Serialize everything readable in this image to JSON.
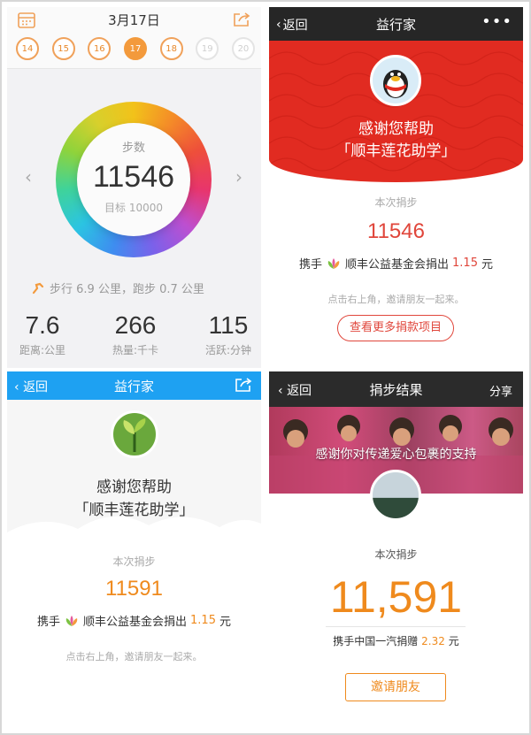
{
  "step_app": {
    "date": "3月17日",
    "days": [
      {
        "label": "14",
        "state": "normal"
      },
      {
        "label": "15",
        "state": "normal"
      },
      {
        "label": "16",
        "state": "normal"
      },
      {
        "label": "17",
        "state": "selected"
      },
      {
        "label": "18",
        "state": "normal"
      },
      {
        "label": "19",
        "state": "dim"
      },
      {
        "label": "20",
        "state": "dim"
      }
    ],
    "ring_label": "步数",
    "steps": "11546",
    "target": "目标 10000",
    "walk_summary": "步行 6.9 公里，跑步 0.7 公里",
    "stats": [
      {
        "value": "7.6",
        "label": "距离:公里"
      },
      {
        "value": "266",
        "label": "热量:千卡"
      },
      {
        "value": "115",
        "label": "活跃:分钟"
      }
    ]
  },
  "charity_red": {
    "back": "返回",
    "title": "益行家",
    "more": "•••",
    "thanks_line1": "感谢您帮助",
    "thanks_line2": "「顺丰莲花助学」",
    "ben_label": "本次捐步",
    "steps": "11546",
    "donate_prefix": "携手",
    "donate_org": "顺丰公益基金会捐出",
    "donate_amount": "1.15",
    "donate_unit": "元",
    "hint": "点击右上角，邀请朋友一起来。",
    "more_button": "查看更多捐款项目",
    "accent": "#e0463b"
  },
  "charity_blue": {
    "back": "返回",
    "title": "益行家",
    "thanks_line1": "感谢您帮助",
    "thanks_line2": "「顺丰莲花助学」",
    "ben_label": "本次捐步",
    "steps": "11591",
    "donate_prefix": "携手",
    "donate_org": "顺丰公益基金会捐出",
    "donate_amount": "1.15",
    "donate_unit": "元",
    "hint": "点击右上角，邀请朋友一起来。",
    "accent": "#1ea1f2"
  },
  "step_result": {
    "back": "返回",
    "title": "捐步结果",
    "share": "分享",
    "photo_caption": "感谢你对传递爱心包裹的支持",
    "ben_label": "本次捐步",
    "steps": "11,591",
    "donate_text": "携手中国一汽捐赠",
    "donate_amount": "2.32",
    "donate_unit": "元",
    "invite_button": "邀请朋友",
    "accent": "#ef8a1d"
  }
}
